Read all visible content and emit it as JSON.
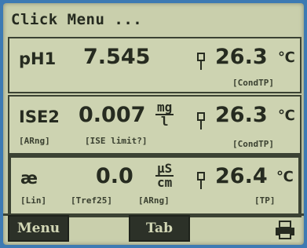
{
  "header": {
    "title": "Click Menu",
    "dots": "..."
  },
  "channels": [
    {
      "name": "pH1",
      "value": "7.545",
      "unit_num": "",
      "unit_den": "",
      "temp": "26.3",
      "temp_unit": "℃",
      "notes": [
        "",
        "",
        "[CondTP]"
      ],
      "selected": false
    },
    {
      "name": "ISE2",
      "value": "0.007",
      "unit_num": "mg",
      "unit_den": "l",
      "temp": "26.3",
      "temp_unit": "℃",
      "notes": [
        "[ARng]",
        "[ISE limit?]",
        "[CondTP]"
      ],
      "selected": false
    },
    {
      "name": "æ",
      "value": "0.0",
      "unit_num": "μS",
      "unit_den": "cm",
      "temp": "26.4",
      "temp_unit": "℃",
      "notes": [
        "[Lin]",
        "[Tref25]",
        "[ARng]",
        "[TP]"
      ],
      "selected": true
    }
  ],
  "softkeys": {
    "left": "Menu",
    "center": "Tab",
    "right_icon": "print-icon"
  }
}
